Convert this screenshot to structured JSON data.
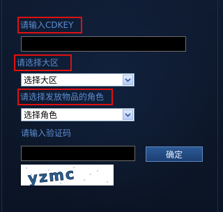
{
  "cdkey": {
    "label": "请输入CDKEY",
    "value": ""
  },
  "region": {
    "label": "请选择大区",
    "selected": "选择大区"
  },
  "character": {
    "label": "请选择发放物品的角色",
    "selected": "选择角色"
  },
  "captcha": {
    "label": "请输入验证码",
    "value": "",
    "confirm_label": "确定",
    "image_text": "yzmc"
  },
  "colors": {
    "label": "#5c8ed2",
    "highlight_border": "#e01010",
    "background": "#0c1526"
  }
}
